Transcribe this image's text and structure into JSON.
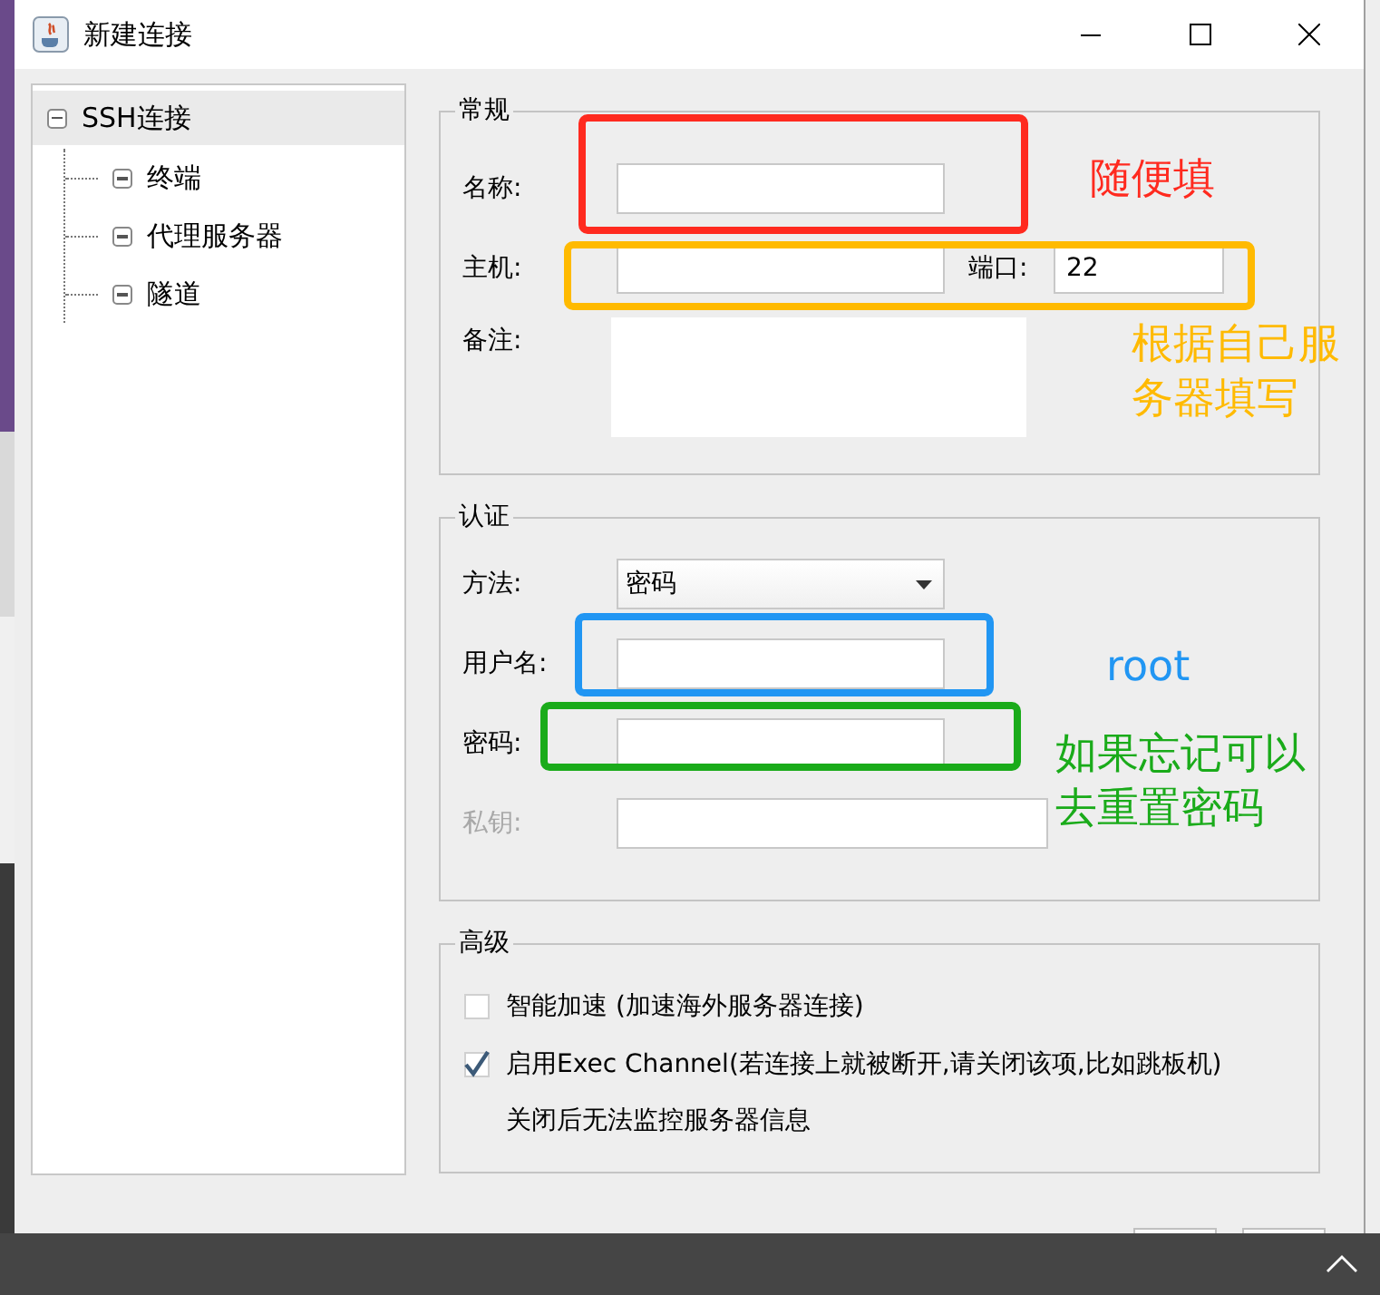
{
  "window": {
    "title": "新建连接"
  },
  "tree": {
    "label": "SSH连接",
    "selected": true,
    "children": [
      {
        "label": "终端",
        "selected": false
      },
      {
        "label": "代理服务器",
        "selected": false
      },
      {
        "label": "隧道",
        "selected": false
      }
    ]
  },
  "general": {
    "title": "常规",
    "name_label": "名称:",
    "host_label": "主机:",
    "port_label": "端口:",
    "port_value": "22",
    "note_label": "备注:"
  },
  "auth": {
    "title": "认证",
    "method_label": "方法:",
    "method_value": "密码",
    "username_label": "用户名:",
    "password_label": "密码:",
    "key_label": "私钥:",
    "key_disabled": true
  },
  "advanced": {
    "title": "高级",
    "options": [
      {
        "label": "智能加速 (加速海外服务器连接)",
        "checked": false
      },
      {
        "label": "启用Exec Channel(若连接上就被断开,请关闭该项,比如跳板机)",
        "checked": true,
        "note": "关闭后无法监控服务器信息"
      }
    ]
  },
  "annotations": [
    {
      "lines": [
        "随便填"
      ],
      "color": "#ff2a1f"
    },
    {
      "lines": [
        "根据自己服",
        "务器填写"
      ],
      "color": "#ffba00"
    },
    {
      "lines": [
        "root"
      ],
      "color": "#2196f3"
    },
    {
      "lines": [
        "如果忘记可以",
        "去重置密码"
      ],
      "color": "#1aab1a"
    }
  ]
}
